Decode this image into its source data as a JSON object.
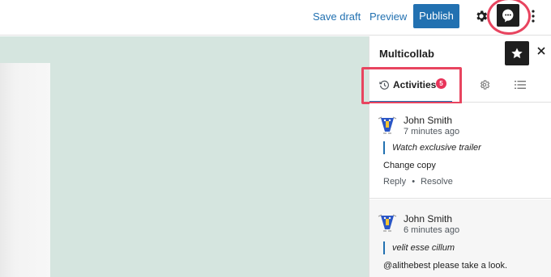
{
  "toolbar": {
    "save_draft_label": "Save draft",
    "preview_label": "Preview",
    "publish_label": "Publish",
    "settings_icon": "gear-icon",
    "multicollab_icon": "speech-bubble-icon",
    "more_icon": "vertical-ellipsis-icon"
  },
  "sidebar": {
    "title": "Multicollab",
    "star_icon": "star-icon",
    "close_icon": "close-icon",
    "tabs": [
      {
        "label": "Activities",
        "icon": "history-icon",
        "badge": "5",
        "active": true
      },
      {
        "label": "",
        "icon": "gear-icon"
      },
      {
        "label": "",
        "icon": "list-icon"
      }
    ]
  },
  "comments": [
    {
      "author": "John Smith",
      "time": "7 minutes ago",
      "quote": "Watch exclusive trailer",
      "text": "Change copy",
      "reply_label": "Reply",
      "separator": "•",
      "resolve_label": "Resolve"
    },
    {
      "author": "John Smith",
      "time": "6 minutes ago",
      "quote": "velit esse cillum",
      "text": "@alithebest please take a look."
    }
  ],
  "colors": {
    "accent": "#2271b1",
    "highlight_ring": "#e8445f",
    "badge": "#e8345a",
    "canvas": "#d5e5df"
  }
}
